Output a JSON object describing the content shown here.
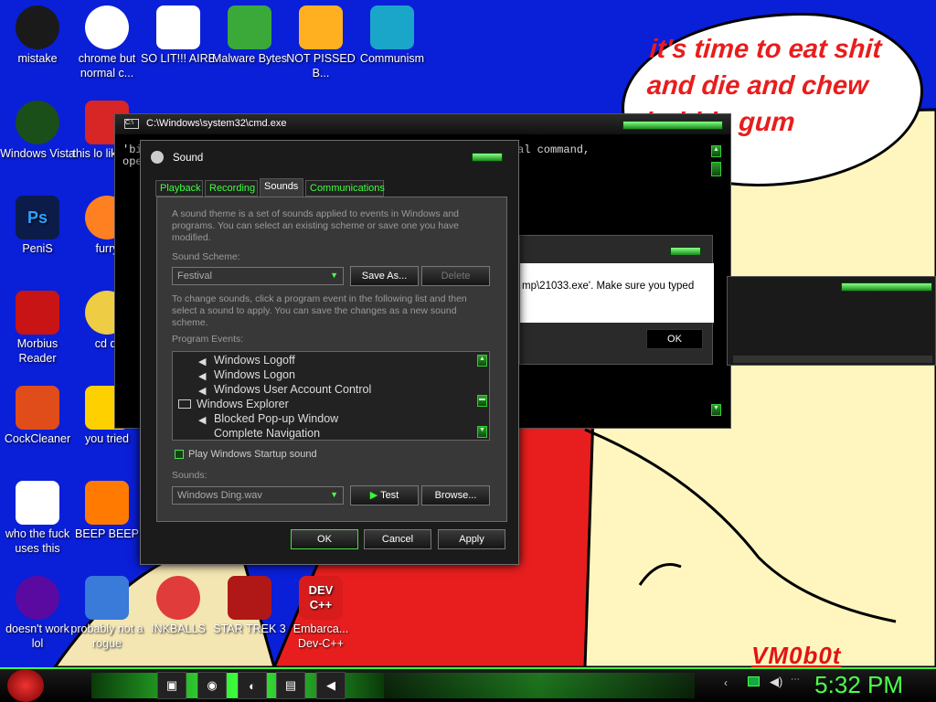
{
  "desktop": {
    "speech_bubble": "it's time to eat shit and die and chew bubble gum",
    "signature": "VM0b0t",
    "icons": [
      {
        "label": "mistake",
        "icon": "xbox-icon"
      },
      {
        "label": "chrome but normal c...",
        "icon": "chrome-icon"
      },
      {
        "label": "SO LIT!!! AIRE",
        "icon": "solitaire-icon"
      },
      {
        "label": "Malware Bytes",
        "icon": "shield-icon"
      },
      {
        "label": "NOT PISSED B...",
        "icon": "pig-icon"
      },
      {
        "label": "Communism",
        "icon": "flag-icon"
      },
      {
        "label": "Windows Vista",
        "icon": "recycle-icon"
      },
      {
        "label": "this lo like a v",
        "icon": "opera-icon"
      },
      {
        "label": "PeniS",
        "icon": "photoshop-icon"
      },
      {
        "label": "furry",
        "icon": "firefox-icon"
      },
      {
        "label": "Morbius Reader",
        "icon": "acrobat-icon"
      },
      {
        "label": "cd di",
        "icon": "cd-icon"
      },
      {
        "label": "CockCleaner",
        "icon": "ccleaner-icon"
      },
      {
        "label": "you tried",
        "icon": "star-icon"
      },
      {
        "label": "who the fuck uses this",
        "icon": "thunder-icon"
      },
      {
        "label": "BEEP BEEP",
        "icon": "vlc-icon"
      },
      {
        "label": "doesn't work lol",
        "icon": "yahoo-icon"
      },
      {
        "label": "probably not a rogue",
        "icon": "gears-icon"
      },
      {
        "label": "INKBALLS",
        "icon": "inkball-icon"
      },
      {
        "label": "STAR TREK 3",
        "icon": "starwars-icon"
      },
      {
        "label": "Embarca... Dev-C++",
        "icon": "devcpp-icon"
      }
    ],
    "devcpp_logo": "DEV C++",
    "photoshop_logo": "Ps"
  },
  "cmd": {
    "title": "C:\\Windows\\system32\\cmd.exe",
    "line1": "'bi",
    "line1b": "al command,",
    "line2": "ope"
  },
  "error": {
    "message": "mp\\21033.exe'. Make sure you typed",
    "ok": "OK"
  },
  "sound": {
    "title": "Sound",
    "tabs": [
      "Playback",
      "Recording",
      "Sounds",
      "Communications"
    ],
    "intro": "A sound theme is a set of sounds applied to events in Windows and programs.  You can select an existing scheme or save one you have modified.",
    "scheme_label": "Sound Scheme:",
    "scheme_value": "Festival",
    "save_as": "Save As...",
    "delete": "Delete",
    "change_text": "To change sounds, click a program event in the following list and then select a sound to apply.  You can save the changes as a new sound scheme.",
    "events_label": "Program Events:",
    "events": [
      "Windows Logoff",
      "Windows Logon",
      "Windows User Account Control",
      "Windows Explorer",
      "Blocked Pop-up Window",
      "Complete Navigation"
    ],
    "startup_label": "Play Windows Startup sound",
    "sounds_label": "Sounds:",
    "sound_value": "Windows Ding.wav",
    "test": "Test",
    "browse": "Browse...",
    "ok": "OK",
    "cancel": "Cancel",
    "apply": "Apply"
  },
  "taskbar": {
    "clock": "5:32 PM"
  },
  "colors": {
    "accent": "#3cff3c",
    "wallpaper": "#0a1fd8",
    "bubble_text": "#e81d1d"
  }
}
